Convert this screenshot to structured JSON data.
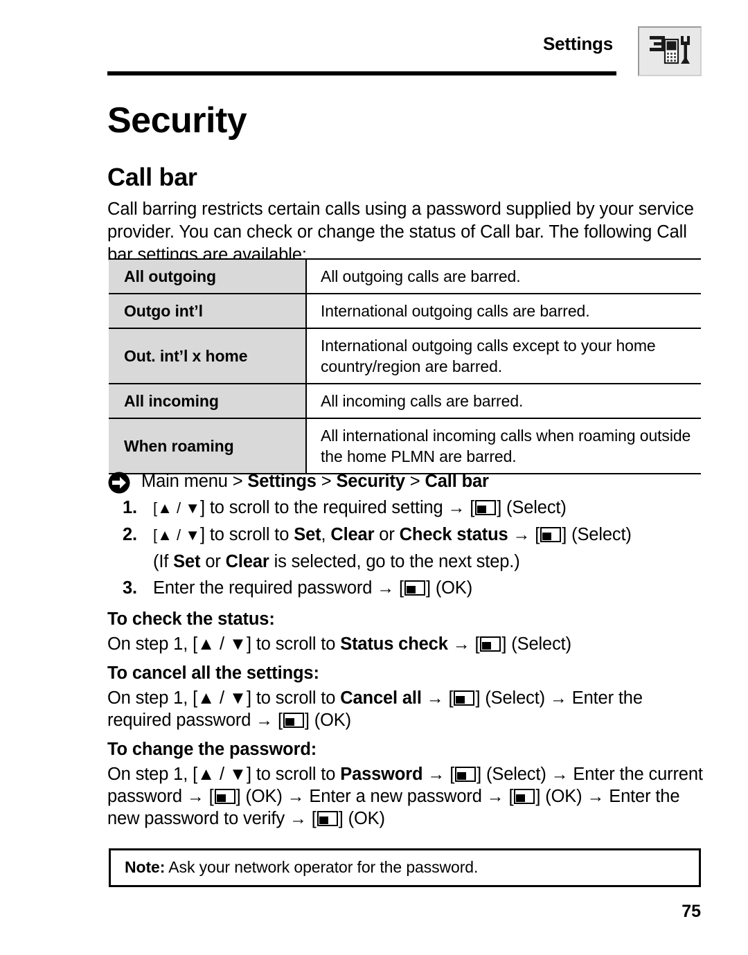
{
  "header": {
    "title": "Settings",
    "icon": "settings-tools-icon"
  },
  "chapter_title": "Security",
  "section_title": "Call bar",
  "intro": "Call barring restricts certain calls using a password supplied by your service provider. You can check or change the status of Call bar. The following Call bar settings are available:",
  "table": {
    "rows": [
      {
        "key": "All outgoing",
        "value": "All outgoing calls are barred."
      },
      {
        "key": "Outgo int’l",
        "value": "International outgoing calls are barred."
      },
      {
        "key": "Out. int’l x home",
        "value": "International outgoing calls except to your home country/region are barred."
      },
      {
        "key": "All incoming",
        "value": "All incoming calls are barred."
      },
      {
        "key": "When roaming",
        "value": "All international incoming calls when roaming outside the home PLMN are barred."
      }
    ]
  },
  "procedure": {
    "nav_icon": "arrow-right-circle-icon",
    "nav_path_prefix": "Main menu > ",
    "nav_path_1": "Settings",
    "nav_sep_1": " > ",
    "nav_path_2": "Security",
    "nav_sep_2": " > ",
    "nav_path_3": "Call bar",
    "steps": [
      {
        "num": "1.",
        "pre": "] to scroll to the required setting ",
        "post": "] (Select)",
        "keys": "[▲ / ▼"
      },
      {
        "num": "2.",
        "pre_a": "] to scroll to ",
        "bold_a": "Set",
        "mid_a": ", ",
        "bold_b": "Clear",
        "mid_b": " or ",
        "bold_c": "Check status",
        "post": "] (Select)",
        "keys": "[▲ / ▼"
      },
      {
        "num": "3.",
        "pre": "Enter the required password ",
        "post": "] (OK)"
      }
    ],
    "substep_note_pre": "(If ",
    "substep_note_bold_a": "Set",
    "substep_note_mid": " or ",
    "substep_note_bold_b": "Clear",
    "substep_note_post": " is selected, go to the next step.)"
  },
  "check_status": {
    "heading": "To check the status:",
    "pre": "On step 1, [▲ / ▼] to scroll to ",
    "bold": "Status check",
    "post": "] (Select)"
  },
  "cancel_all": {
    "heading": "To cancel all the settings:",
    "pre": "On step 1, [▲ / ▼] to scroll to ",
    "bold": "Cancel all",
    "mid": "] (Select) ",
    "mid2": " Enter the required password ",
    "post": "] (OK)"
  },
  "change_password": {
    "heading": "To change the password:",
    "pre": "On step 1, [▲ / ▼] to scroll to ",
    "bold": "Password",
    "seg1": "] (Select) ",
    "seg2": " Enter the current password ",
    "seg3": "] (OK) ",
    "seg4": " Enter a new password ",
    "seg5": "] (OK) ",
    "seg6": " Enter the new password to verify ",
    "seg7": "] (OK)"
  },
  "note": {
    "label": "Note:",
    "text": " Ask your network operator for the password."
  },
  "page_number": "75",
  "glyphs": {
    "arrow_right": "→",
    "bracket_open": "[",
    "bracket_close": "]",
    "up_triangle": "▲",
    "down_triangle": "▼",
    "slash": "/",
    "gt": ">"
  },
  "colors": {
    "table_key_bg": "#d9d9d9",
    "rule": "#000000",
    "icon_bg": "#e8e8e8",
    "page_bg": "#ffffff"
  }
}
